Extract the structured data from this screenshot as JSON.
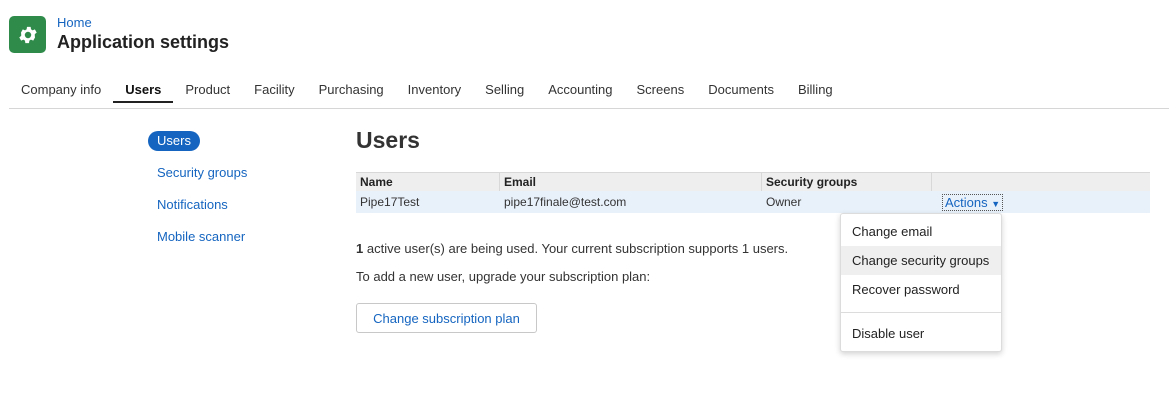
{
  "header": {
    "breadcrumb": "Home",
    "title": "Application settings"
  },
  "tabs": [
    {
      "label": "Company info"
    },
    {
      "label": "Users"
    },
    {
      "label": "Product"
    },
    {
      "label": "Facility"
    },
    {
      "label": "Purchasing"
    },
    {
      "label": "Inventory"
    },
    {
      "label": "Selling"
    },
    {
      "label": "Accounting"
    },
    {
      "label": "Screens"
    },
    {
      "label": "Documents"
    },
    {
      "label": "Billing"
    }
  ],
  "active_tab": "Users",
  "side_nav": {
    "items": [
      {
        "label": "Users"
      },
      {
        "label": "Security groups"
      },
      {
        "label": "Notifications"
      },
      {
        "label": "Mobile scanner"
      }
    ],
    "active": "Users"
  },
  "main": {
    "title": "Users",
    "table": {
      "headers": [
        "Name",
        "Email",
        "Security groups",
        ""
      ],
      "rows": [
        {
          "name": "Pipe17Test",
          "email": "pipe17finale@test.com",
          "groups": "Owner",
          "actions": "Actions"
        }
      ]
    },
    "info": {
      "count": "1",
      "active_text": " active user(s) are being used. Your current subscription supports 1 users.",
      "upgrade_text": "To add a new user, upgrade your subscription plan:"
    },
    "subscription_button": "Change subscription plan"
  },
  "actions_menu": {
    "items": [
      "Change email",
      "Change security groups",
      "Recover password",
      "Disable user"
    ],
    "hovered": "Change security groups"
  },
  "colors": {
    "accent": "#1565c0",
    "app_icon": "#2e8b4a",
    "row_bg": "#e8f0fa"
  },
  "icons": {
    "app": "gear-icon",
    "caret": "caret-down-icon"
  }
}
